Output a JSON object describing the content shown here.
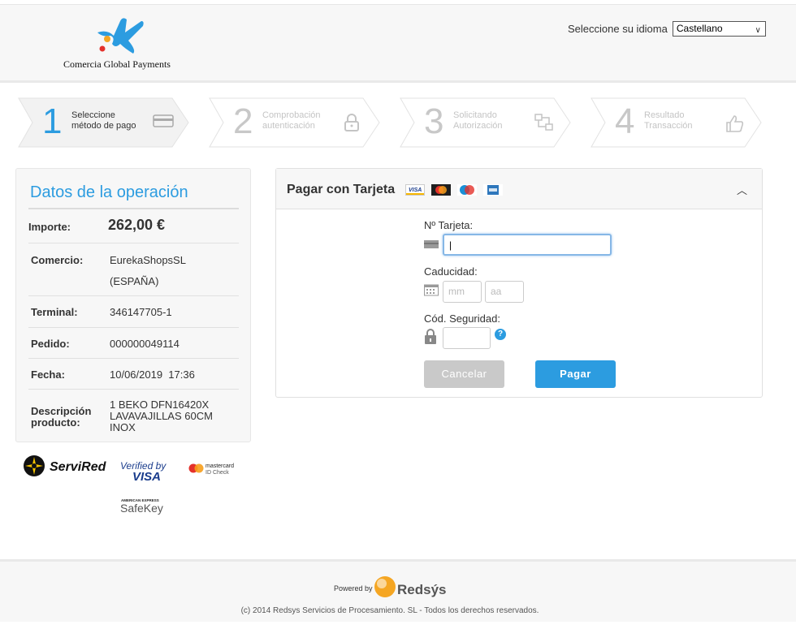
{
  "brand": {
    "logo_text": "Comercia Global Payments"
  },
  "language": {
    "label": "Seleccione su idioma",
    "selected": "Castellano"
  },
  "steps": [
    {
      "number": "1",
      "line1": "Seleccione",
      "line2": "método de pago",
      "icon": "card-icon",
      "active": true
    },
    {
      "number": "2",
      "line1": "Comprobación",
      "line2": "autenticación",
      "icon": "lock-icon",
      "active": false
    },
    {
      "number": "3",
      "line1": "Solicitando",
      "line2": "Autorización",
      "icon": "network-icon",
      "active": false
    },
    {
      "number": "4",
      "line1": "Resultado",
      "line2": "Transacción",
      "icon": "thumbs-up-icon",
      "active": false
    }
  ],
  "operation": {
    "title": "Datos de la operación",
    "rows": [
      {
        "key": "Importe:",
        "value": "262,00 €"
      },
      {
        "key": "Comercio:",
        "value_line1": "EurekaShopsSL",
        "value_line2": "(ESPAÑA)"
      },
      {
        "key": "Terminal:",
        "value": "346147705-1"
      },
      {
        "key": "Pedido:",
        "value": "000000049114"
      },
      {
        "key": "Fecha:",
        "value": "10/06/2019  17:36"
      },
      {
        "key_line1": "Descripción",
        "key_line2": "producto:",
        "value_line1": "1 BEKO DFN16420X",
        "value_line2": "LAVAVAJILLAS 60CM",
        "value_line3": "INOX"
      }
    ]
  },
  "security_logos": {
    "servired": "ServiRed",
    "verified_line1": "Verified by",
    "verified_line2": "VISA",
    "mastercard_line1": "mastercard",
    "mastercard_line2": "ID Check",
    "amex_line1": "AMERICAN EXPRESS",
    "amex_line2": "SafeKey"
  },
  "payment": {
    "title": "Pagar con Tarjeta",
    "card_brands": [
      "VISA",
      "MC",
      "Maestro",
      "AMEX"
    ],
    "card_number_label": "Nº Tarjeta:",
    "card_number_value": "|",
    "expiry_label": "Caducidad:",
    "month_placeholder": "mm",
    "year_placeholder": "aa",
    "cvv_label": "Cód. Seguridad:",
    "help_symbol": "?",
    "cancel_label": "Cancelar",
    "pay_label": "Pagar"
  },
  "footer": {
    "powered_by": "Powered by",
    "redsys": "Redsýs",
    "copyright": "(c) 2014 Redsys Servicios de Procesamiento. SL - Todos los derechos reservados."
  },
  "colors": {
    "accent": "#2c9ce0",
    "muted": "#c9c9c9"
  }
}
